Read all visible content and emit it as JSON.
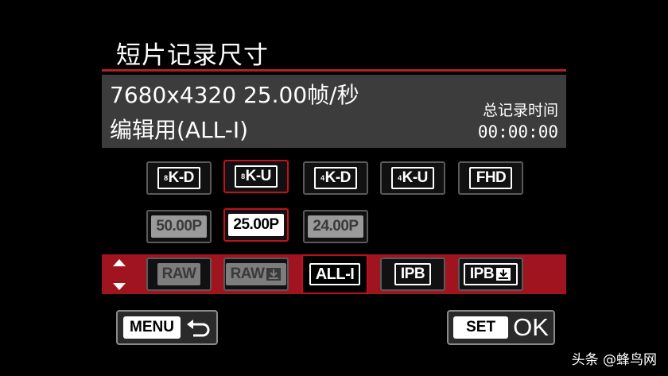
{
  "title": "短片记录尺寸",
  "info": {
    "resolution_fps": "7680x4320 25.00帧/秒",
    "compression_mode": "编辑用(ALL-I)",
    "total_time_label": "总记录时间",
    "total_time_value": "00:00:00"
  },
  "row_size": [
    {
      "sup": "8",
      "text": "K-D"
    },
    {
      "sup": "8",
      "text": "K-U"
    },
    {
      "sup": "4",
      "text": "K-D"
    },
    {
      "sup": "4",
      "text": "K-U"
    },
    {
      "sup": "",
      "text": "FHD"
    }
  ],
  "row_fps": [
    "50.00P",
    "25.00P",
    "24.00P"
  ],
  "row_compression": [
    "RAW",
    "RAW",
    "ALL-I",
    "IPB",
    "IPB"
  ],
  "buttons": {
    "menu_label": "MENU",
    "set_label": "SET",
    "ok_label": "OK"
  },
  "watermark": "头条 @蜂鸟网",
  "colors": {
    "accent_red": "#c4101e",
    "bar_red": "#a01420",
    "panel_grey": "#3c3c3c"
  }
}
